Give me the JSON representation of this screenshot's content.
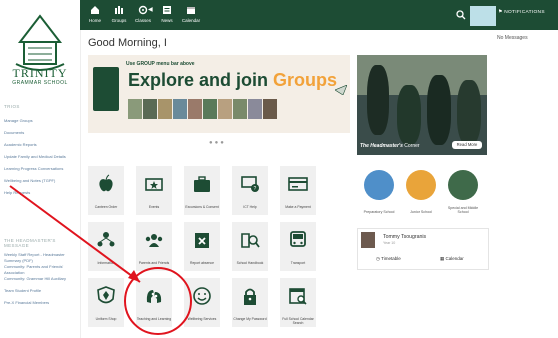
{
  "school": {
    "name": "TRINITY",
    "subtitle": "GRAMMAR SCHOOL"
  },
  "sidebar": {
    "section1": "TRIOS",
    "items": [
      "Manage Groups",
      "Documents",
      "Academic Reports",
      "Update Family and Medical Details",
      "Learning Progress Conversations",
      "Wellbeing and Notes (TGPF)",
      "Help Requests"
    ],
    "section2": "THE HEADMASTER'S MESSAGE",
    "items2": [
      "Weekly Staff Report - Headmaster Summary (PDF)",
      "Community: Parents and Friends' Association",
      "Community: Grammar Hill Auxiliary",
      "Team Student Profile",
      "Pre-X Financial Members"
    ]
  },
  "topbar": {
    "nav": [
      {
        "label": "Home",
        "icon": "home-icon"
      },
      {
        "label": "Groups",
        "icon": "groups-icon"
      },
      {
        "label": "Classes",
        "icon": "classes-icon"
      },
      {
        "label": "News",
        "icon": "news-icon"
      },
      {
        "label": "Calendar",
        "icon": "calendar-icon"
      }
    ],
    "notifications_label": "NOTIFICATIONS",
    "no_messages": "No Messages"
  },
  "greeting": "Good Morning, I",
  "banner": {
    "hint": "Use GROUP menu bar above",
    "title_plain": "Explore and join ",
    "title_highlight": "Groups"
  },
  "photo_panel": {
    "caption_italic": "The Headmaster's",
    "caption_rest": " Corner",
    "button": "Read More"
  },
  "tiles": [
    {
      "label": "Canteen Order",
      "icon": "apple-icon"
    },
    {
      "label": "Events",
      "icon": "ticket-icon"
    },
    {
      "label": "Excursions & Consent",
      "icon": "suitcase-icon"
    },
    {
      "label": "ICT Help",
      "icon": "computer-help-icon"
    },
    {
      "label": "Make a Payment",
      "icon": "payment-card-icon"
    },
    {
      "label": "Information",
      "icon": "people-network-icon"
    },
    {
      "label": "Parents and Friends",
      "icon": "group-people-icon"
    },
    {
      "label": "Report absence",
      "icon": "calendar-x-icon"
    },
    {
      "label": "School Handbook",
      "icon": "handbook-search-icon"
    },
    {
      "label": "Transport",
      "icon": "bus-icon"
    },
    {
      "label": "Uniform Shop",
      "icon": "shield-uniform-icon"
    },
    {
      "label": "Teaching and Learning",
      "icon": "heads-gears-icon"
    },
    {
      "label": "Wellbeing Services",
      "icon": "smiley-icon"
    },
    {
      "label": "Change My Password",
      "icon": "padlock-icon"
    },
    {
      "label": "Full School Calendar Search",
      "icon": "calendar-search-icon"
    }
  ],
  "schools": [
    {
      "label": "Preparatory School"
    },
    {
      "label": "Junior School"
    },
    {
      "label": "Special and Middle School"
    }
  ],
  "profile": {
    "name": "Tommy Tsougranis",
    "year": "Year 10",
    "link1": "Timetable",
    "link2": "Calendar"
  },
  "colors": {
    "primary": "#1d4c34",
    "accent": "#f2a23a",
    "annotation": "#e0141e"
  }
}
